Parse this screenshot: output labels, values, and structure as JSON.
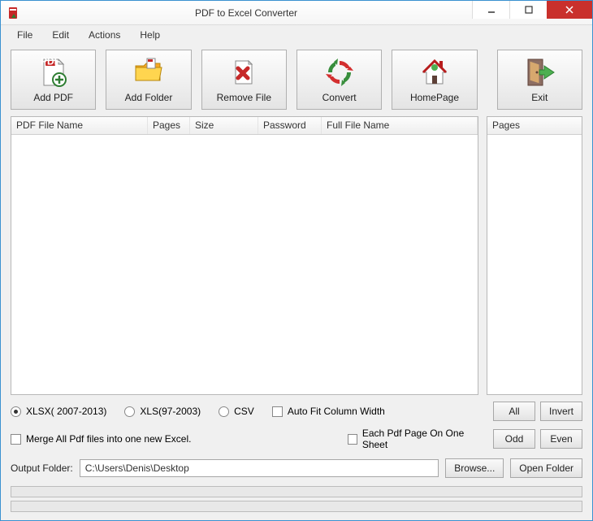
{
  "window": {
    "title": "PDF to Excel Converter"
  },
  "menu": {
    "file": "File",
    "edit": "Edit",
    "actions": "Actions",
    "help": "Help"
  },
  "toolbar": {
    "add_pdf": "Add PDF",
    "add_folder": "Add Folder",
    "remove_file": "Remove File",
    "convert": "Convert",
    "homepage": "HomePage",
    "exit": "Exit"
  },
  "table": {
    "cols": {
      "name": "PDF File Name",
      "pages": "Pages",
      "size": "Size",
      "password": "Password",
      "fullname": "Full File Name"
    }
  },
  "side": {
    "pages": "Pages"
  },
  "options": {
    "xlsx": "XLSX( 2007-2013)",
    "xls": "XLS(97-2003)",
    "csv": "CSV",
    "autofit": "Auto Fit Column Width",
    "merge": "Merge All Pdf files into one new Excel.",
    "each_page": "Each Pdf Page On One Sheet"
  },
  "side_btns": {
    "all": "All",
    "invert": "Invert",
    "odd": "Odd",
    "even": "Even"
  },
  "output": {
    "label": "Output Folder:",
    "value": "C:\\Users\\Denis\\Desktop",
    "browse": "Browse...",
    "open": "Open Folder"
  }
}
